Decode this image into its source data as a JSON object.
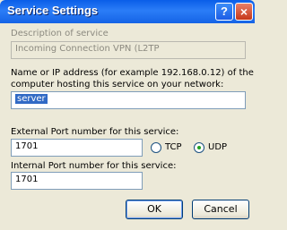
{
  "window": {
    "title": "Service Settings",
    "help_label": "?",
    "close_label": "×"
  },
  "form": {
    "description_label": "Description of service",
    "description_value": "Incoming Connection VPN (L2TP",
    "name_label_line1": "Name or IP address (for example 192.168.0.12) of the",
    "name_label_line2": "computer hosting this service on your network:",
    "name_value": "server",
    "external_port_label": "External Port number for this service:",
    "external_port_value": "1701",
    "protocol_tcp": "TCP",
    "protocol_udp": "UDP",
    "protocol_selected": "UDP",
    "internal_port_label": "Internal Port number for this service:",
    "internal_port_value": "1701"
  },
  "buttons": {
    "ok": "OK",
    "cancel": "Cancel"
  },
  "colors": {
    "title_bar": "#0a5ee8",
    "selection": "#316ac5",
    "udp_dot": "#21a121"
  }
}
